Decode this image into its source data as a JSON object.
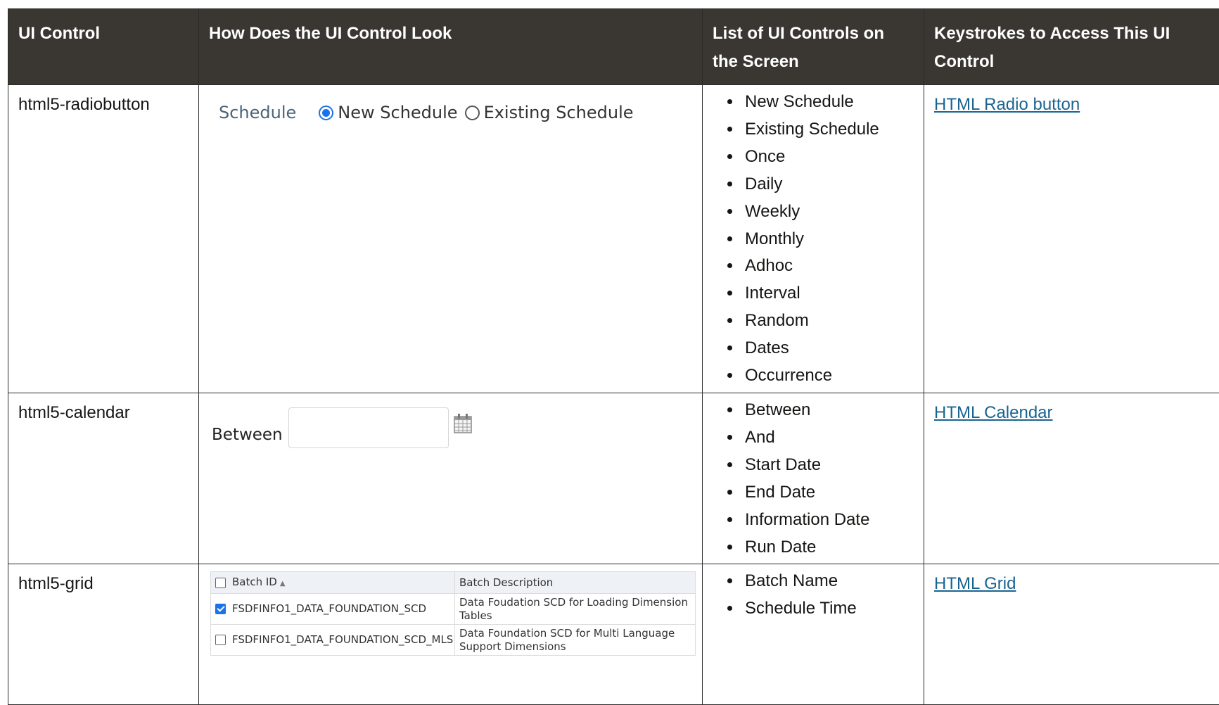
{
  "headers": {
    "ui_control": "UI Control",
    "look": "How Does the UI Control Look",
    "list": "List of UI Controls on the Screen",
    "keystrokes": "Keystrokes to Access This UI Control"
  },
  "rows": [
    {
      "name": "html5-radiobutton",
      "sample": {
        "label": "Schedule",
        "options": [
          "New Schedule",
          "Existing Schedule"
        ],
        "selected": "New Schedule"
      },
      "controls": [
        "New Schedule",
        "Existing Schedule",
        "Once",
        "Daily",
        "Weekly",
        "Monthly",
        "Adhoc",
        "Interval",
        "Random",
        "Dates",
        "Occurrence"
      ],
      "link": "HTML Radio button"
    },
    {
      "name": "html5-calendar",
      "sample": {
        "label": "Between",
        "input_value": "",
        "icon": "calendar-icon"
      },
      "controls": [
        "Between",
        "And",
        "Start Date",
        "End Date",
        "Information Date",
        "Run Date"
      ],
      "link": "HTML Calendar"
    },
    {
      "name": "html5-grid",
      "sample": {
        "columns": [
          "Batch ID",
          "Batch Description"
        ],
        "sort_indicator": "▲",
        "header_checked": false,
        "rows": [
          {
            "checked": true,
            "id": "FSDFINFO1_DATA_FOUNDATION_SCD",
            "description": "Data Foudation SCD for Loading Dimension Tables"
          },
          {
            "checked": false,
            "id": "FSDFINFO1_DATA_FOUNDATION_SCD_MLS",
            "description": "Data Foundation SCD for Multi Language Support Dimensions"
          }
        ]
      },
      "controls": [
        "Batch Name",
        "Schedule Time"
      ],
      "link": "HTML Grid"
    }
  ],
  "colors": {
    "header_bg": "#3a3632",
    "link": "#1a6492",
    "radio_accent": "#1a73e8"
  }
}
